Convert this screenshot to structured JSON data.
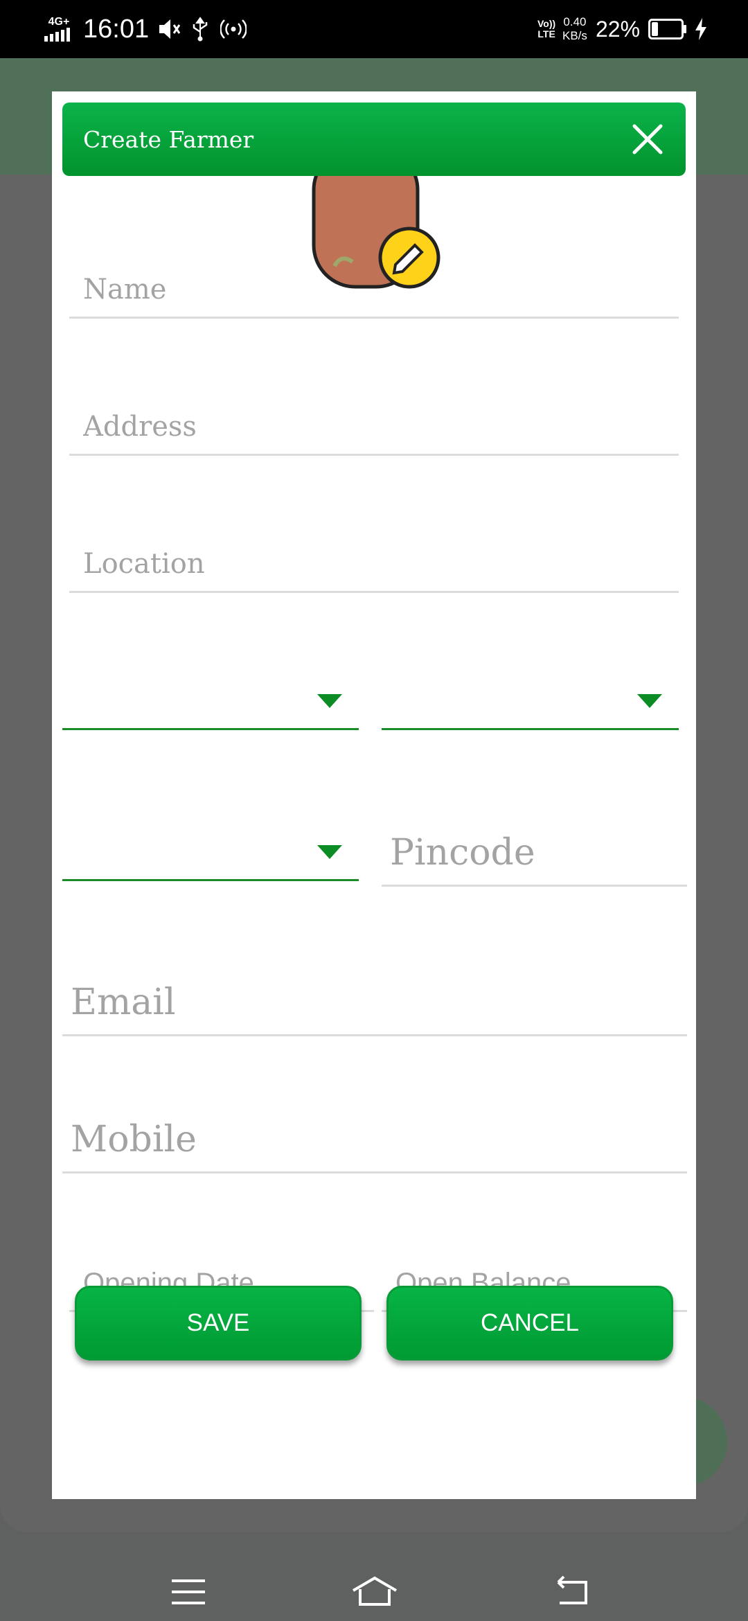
{
  "status_bar": {
    "network": "4G+",
    "time": "16:01",
    "volte": [
      "Vo))",
      "LTE"
    ],
    "speed_value": "0.40",
    "speed_unit": "KB/s",
    "battery_percent": "22%",
    "battery_level": 0.22
  },
  "dialog": {
    "title": "Create Farmer",
    "fields": {
      "name": {
        "placeholder": "Name",
        "value": ""
      },
      "address": {
        "placeholder": "Address",
        "value": ""
      },
      "location": {
        "placeholder": "Location",
        "value": ""
      },
      "pincode": {
        "placeholder": "Pincode",
        "value": ""
      },
      "email": {
        "placeholder": "Email",
        "value": ""
      },
      "mobile": {
        "placeholder": "Mobile",
        "value": ""
      },
      "opening_date": {
        "placeholder": "Opening Date",
        "value": ""
      },
      "open_balance": {
        "placeholder": "Open Balance",
        "value": ""
      }
    },
    "dropdowns": {
      "first": {
        "value": ""
      },
      "second": {
        "value": ""
      },
      "third": {
        "value": ""
      }
    },
    "buttons": {
      "save": "SAVE",
      "cancel": "CANCEL"
    }
  },
  "colors": {
    "primary_green": "#08a83e",
    "header_green": "#0bb34a",
    "underline_green": "#1a8a2a",
    "placeholder_gray": "#a3a3a3",
    "scrim": "#5f6060"
  },
  "icons": {
    "close": "close-icon",
    "avatar": "farmer-avatar-icon",
    "nav_menu": "menu-icon",
    "nav_home": "home-icon",
    "nav_back": "back-icon"
  }
}
